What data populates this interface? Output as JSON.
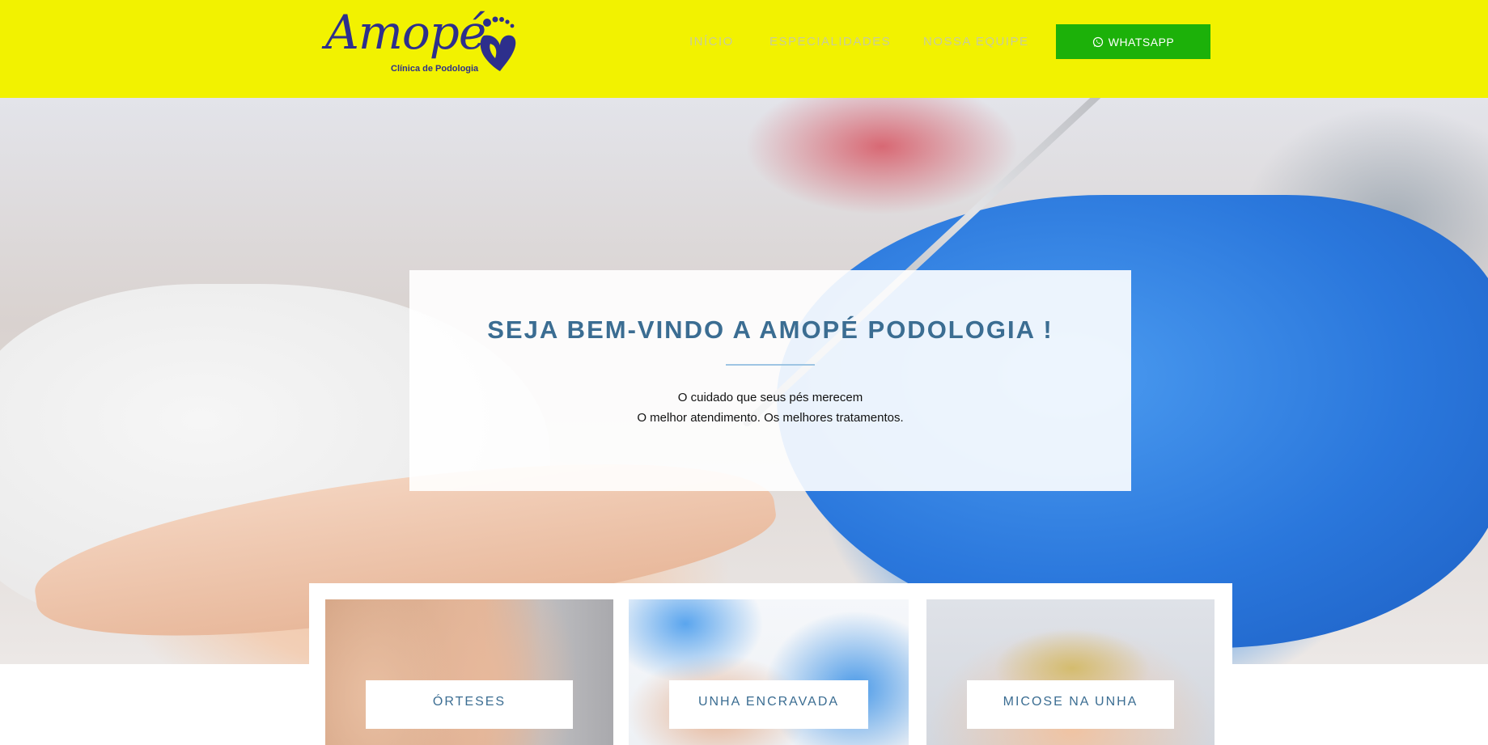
{
  "header": {
    "logo_text": "Amopé",
    "logo_subtitle": "Clínica de Podologia",
    "nav": [
      {
        "label": "INÍCIO"
      },
      {
        "label": "ESPECIALIDADES"
      },
      {
        "label": "NOSSA EQUIPE"
      }
    ],
    "whatsapp_label": "WHATSAPP"
  },
  "hero": {
    "title": "SEJA BEM-VINDO A AMOPÉ PODOLOGIA !",
    "line1": "O cuidado que seus pés merecem",
    "line2": "O melhor atendimento. Os melhores tratamentos."
  },
  "specialties": [
    {
      "label": "ÓRTESES"
    },
    {
      "label": "UNHA ENCRAVADA"
    },
    {
      "label": "MICOSE NA UNHA"
    }
  ],
  "colors": {
    "header_bg": "#f2f200",
    "brand_blue": "#2d2f8c",
    "whatsapp_green": "#1cb109",
    "accent_text": "#3b6d92"
  },
  "icons": {
    "logo": "feet-heart-icon",
    "whatsapp": "whatsapp-icon"
  }
}
